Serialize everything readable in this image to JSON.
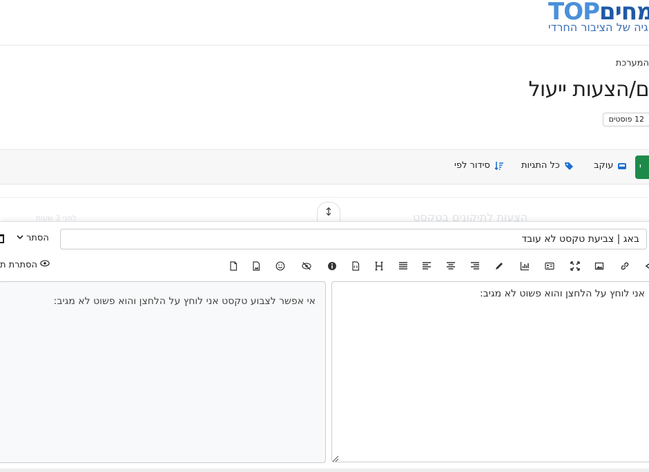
{
  "header": {
    "logo_latin": "TOP",
    "logo_hebrew": "מחים",
    "logo_tagline": "הגיה של הציבור החרדי"
  },
  "breadcrumb": "המערכת",
  "page_title": "ם/הצעות ייעול",
  "posts_badge": "12 פוסטים",
  "topic_bar": {
    "green_button_label": "י",
    "watching_label": "עוקב",
    "tags_label": "כל התגיות",
    "sort_label": "סידור לפי"
  },
  "background_list": {
    "faded_title": "הצעות לתיקונים בטקסט",
    "faded_meta": "לפני 3 שעות"
  },
  "composer": {
    "title_value": "באג | צביעת טקסט לא עובד",
    "hide_label": "הסתר",
    "preview_toggle_label": "הסתרת ת",
    "editor_text": "אני לוחץ על הלחצן והוא פשוט לא מגיב:",
    "preview_text": "אי אפשר לצבוע טקסט אני לוחץ על הלחצן והוא פשוט לא מגיב:"
  },
  "colors": {
    "accent_green": "#1e8a4a",
    "logo_blue": "#4a90d9",
    "icon_blue": "#1f6fd1"
  },
  "icons": [
    "link-icon",
    "image-icon",
    "fullscreen-icon",
    "id-card-icon",
    "chart-icon",
    "pen-icon",
    "align-right-icon",
    "align-center-icon",
    "align-left-icon",
    "justify-icon",
    "heading-icon",
    "code-file-icon",
    "info-icon",
    "eye-slash-icon",
    "smile-icon",
    "file-image-icon",
    "file-icon"
  ]
}
